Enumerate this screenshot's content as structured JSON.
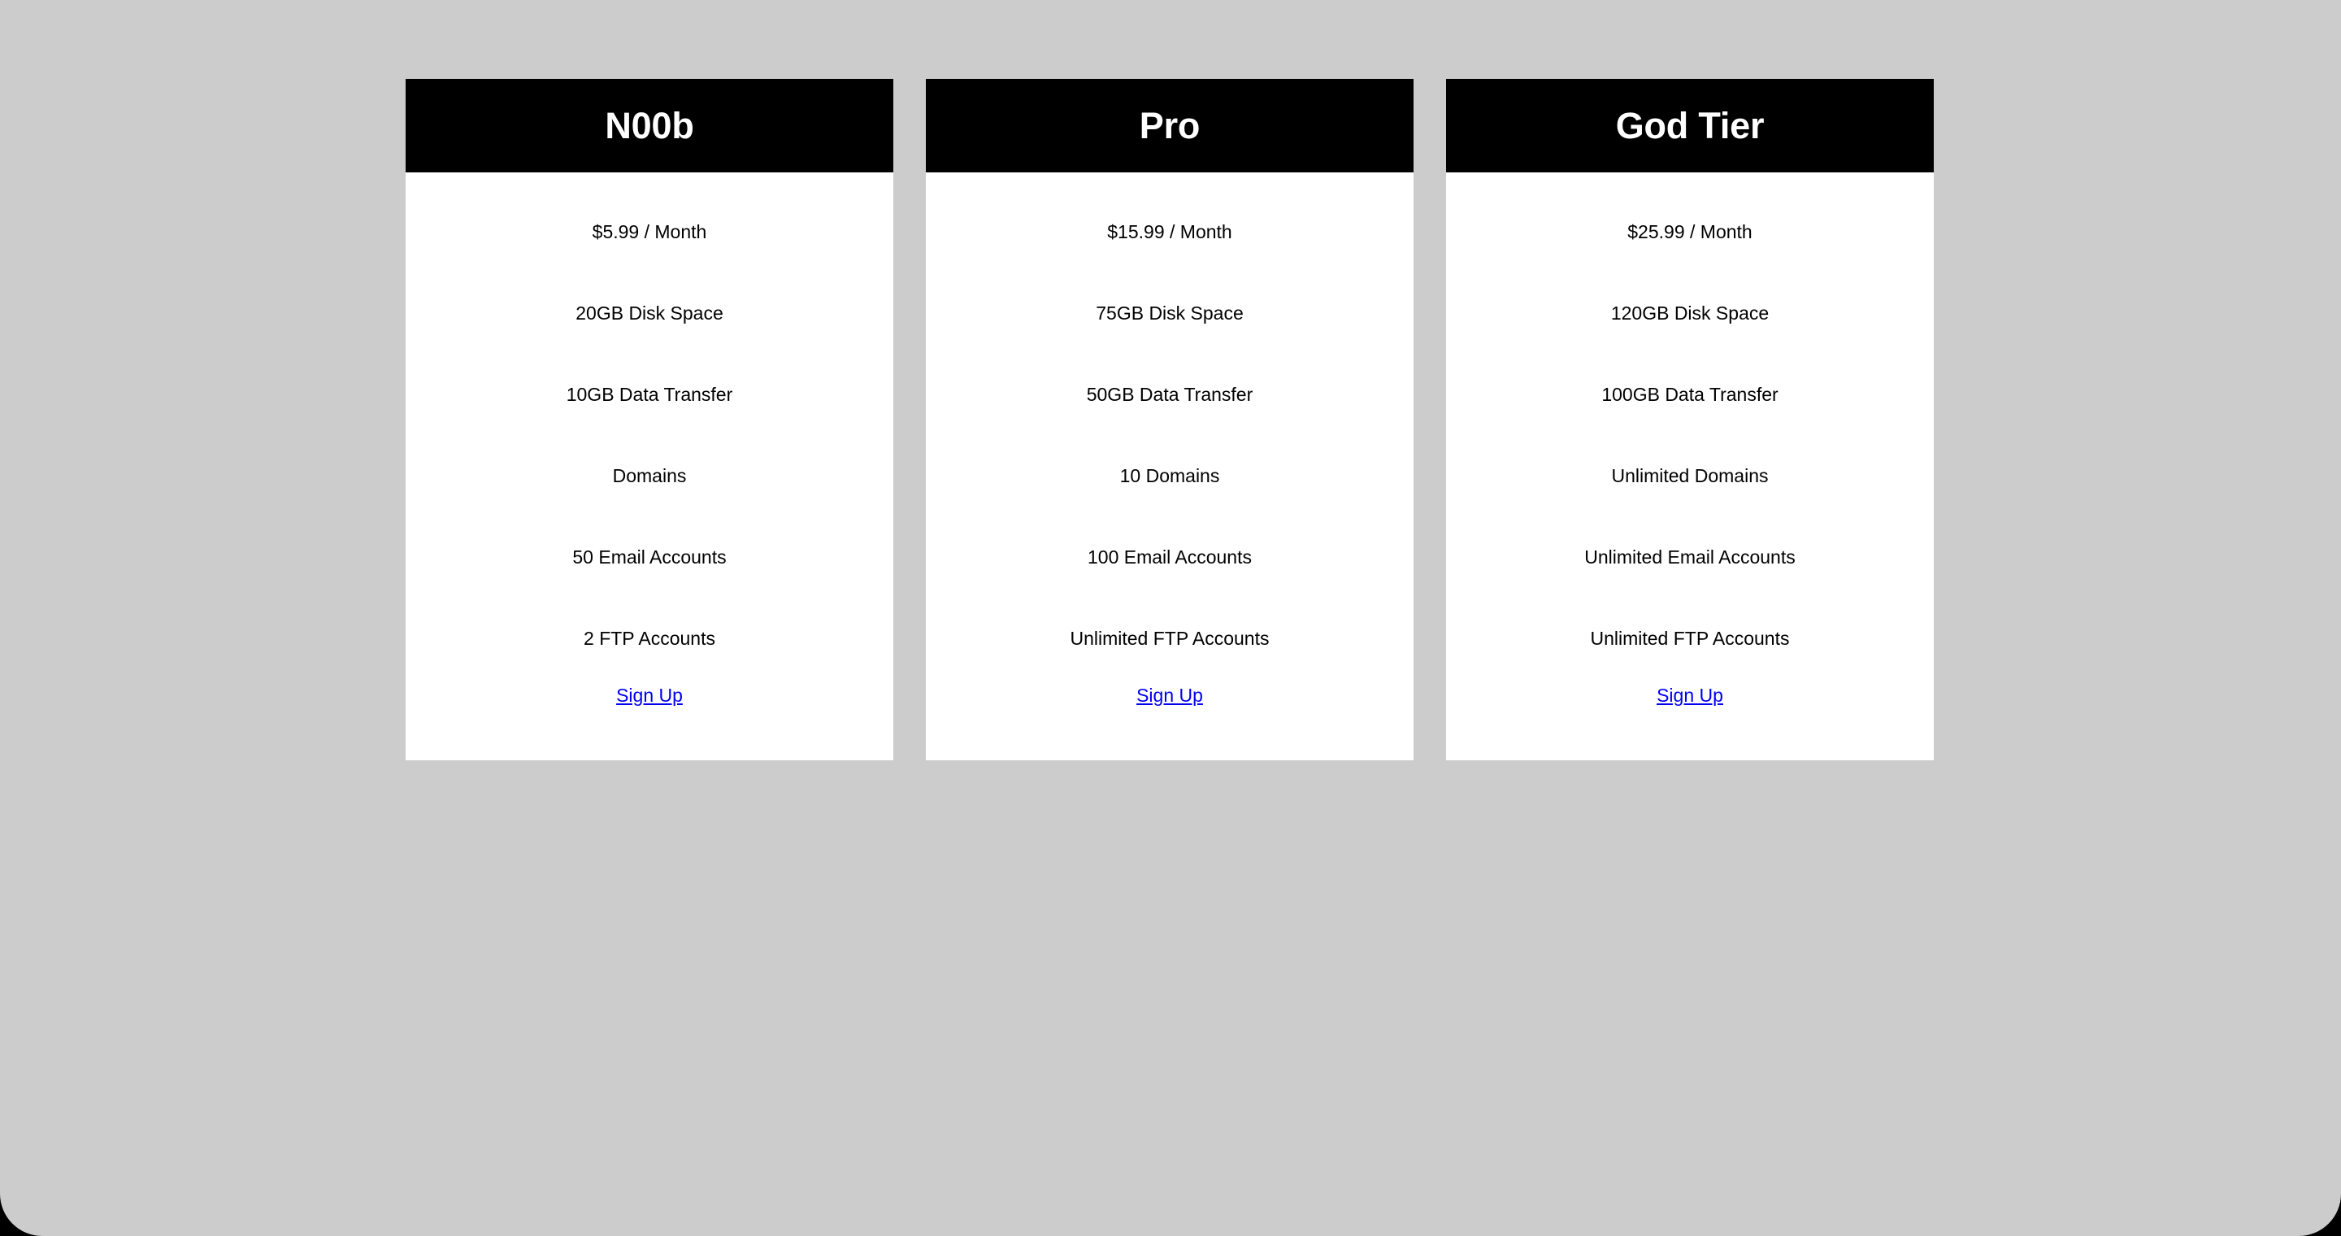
{
  "page": {
    "background_color": "#cccccc",
    "header_background_color": "#000000",
    "card_background_color": "#ffffff",
    "link_color": "#0000ee",
    "text_color": "#000000"
  },
  "plans": [
    {
      "name": "N00b",
      "price": "$5.99 / Month",
      "features": [
        "20GB Disk Space",
        "10GB Data Transfer",
        "Domains",
        "50 Email Accounts",
        "2 FTP Accounts"
      ],
      "signup_label": "Sign Up"
    },
    {
      "name": "Pro",
      "price": "$15.99 / Month",
      "features": [
        "75GB Disk Space",
        "50GB Data Transfer",
        "10 Domains",
        "100 Email Accounts",
        "Unlimited FTP Accounts"
      ],
      "signup_label": "Sign Up"
    },
    {
      "name": "God Tier",
      "price": "$25.99 / Month",
      "features": [
        "120GB Disk Space",
        "100GB Data Transfer",
        "Unlimited Domains",
        "Unlimited Email Accounts",
        "Unlimited FTP Accounts"
      ],
      "signup_label": "Sign Up"
    }
  ]
}
